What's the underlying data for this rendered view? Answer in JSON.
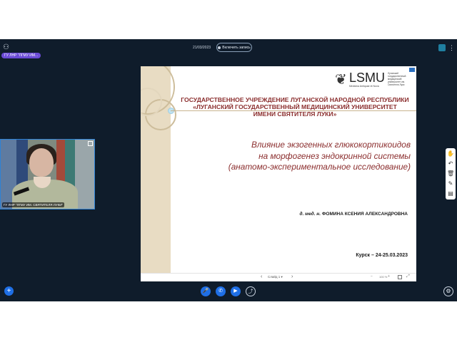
{
  "topbar": {
    "participant_chip": "ГУ ЛНР \"ЛГМУ ИМ...",
    "time": "21/03/2023",
    "record_label": "Включить запись"
  },
  "webcam": {
    "label": "ГУ ЛНР \"ЛГМУ ИМ. СВЯТИТЕЛЯ ЛУКИ\""
  },
  "slide": {
    "logo_text": "LSMU",
    "logo_sub": "Medicina Antiquae et Nova",
    "logo_side": "Луганский государственный медицинский университет им. Святителя Луки",
    "institution": [
      "ГОСУДАРСТВЕННОЕ УЧРЕЖДЕНИЕ ЛУГАНСКОЙ НАРОДНОЙ РЕСПУБЛИКИ",
      "«ЛУГАНСКИЙ ГОСУДАРСТВЕННЫЙ МЕДИЦИНСКИЙ УНИВЕРСИТЕТ",
      "ИМЕНИ СВЯТИТЕЛЯ ЛУКИ»"
    ],
    "title": [
      "Влияние экзогенных глюкокортикоидов",
      "на морфогенез эндокринной системы",
      "(анатомо-экспериментальное исследование)"
    ],
    "author_degree": "д. мед. н.",
    "author_name": "ФОМИНА КСЕНИЯ АЛЕКСАНДРОВНА",
    "city_date": "Курск – 24-25.03.2023"
  },
  "slide_controls": {
    "slide_selector": "Слайд 1",
    "zoom": "100 %"
  },
  "colors": {
    "background": "#0f1c2b",
    "accent": "#1f6fe6",
    "slide_title": "#8b2e2e"
  }
}
